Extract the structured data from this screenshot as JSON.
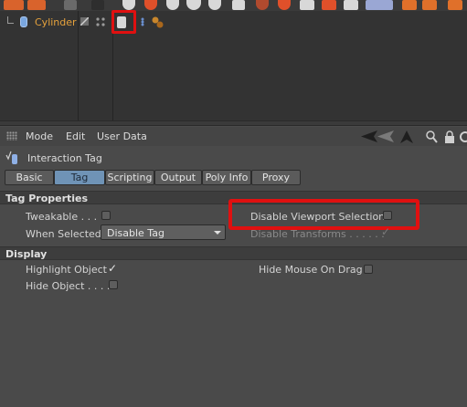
{
  "object_manager": {
    "object_name": "Cylinder"
  },
  "attribute_manager": {
    "menu": [
      "Mode",
      "Edit",
      "User Data"
    ],
    "tag_title": "Interaction Tag",
    "tabs": [
      {
        "label": "Basic",
        "active": false
      },
      {
        "label": "Tag",
        "active": true
      },
      {
        "label": "Scripting",
        "active": false
      },
      {
        "label": "Output",
        "active": false
      },
      {
        "label": "Poly Info",
        "active": false
      },
      {
        "label": "Proxy",
        "active": false
      }
    ],
    "tag_properties": {
      "header": "Tag Properties",
      "tweakable_label": "Tweakable . . .",
      "tweakable_checked": false,
      "disable_viewport_selection_label": "Disable Viewport Selection",
      "disable_viewport_selection_checked": false,
      "when_selected_label": "When Selected",
      "when_selected_value": "Disable Tag",
      "disable_transforms_label": "Disable Transforms . . . . . .",
      "disable_transforms_checked": true
    },
    "display": {
      "header": "Display",
      "highlight_object_label": "Highlight Object",
      "highlight_object_checked": true,
      "hide_mouse_on_drag_label": "Hide Mouse On Drag",
      "hide_mouse_on_drag_checked": false,
      "hide_object_label": "Hide Object . . . .",
      "hide_object_checked": false
    }
  },
  "colors": {
    "object_name": "#e6a23c",
    "active_tab": "#6f93b6",
    "highlight_box": "#e01010",
    "panel_bg": "#4a4a4a"
  },
  "icons": [
    "cube-icon",
    "pointer-icon",
    "sphere-icon",
    "cone-icon",
    "layer-icon",
    "lock-icon",
    "search-icon",
    "arrow-left-icon",
    "arrow-up-icon",
    "checkmark-icon"
  ]
}
